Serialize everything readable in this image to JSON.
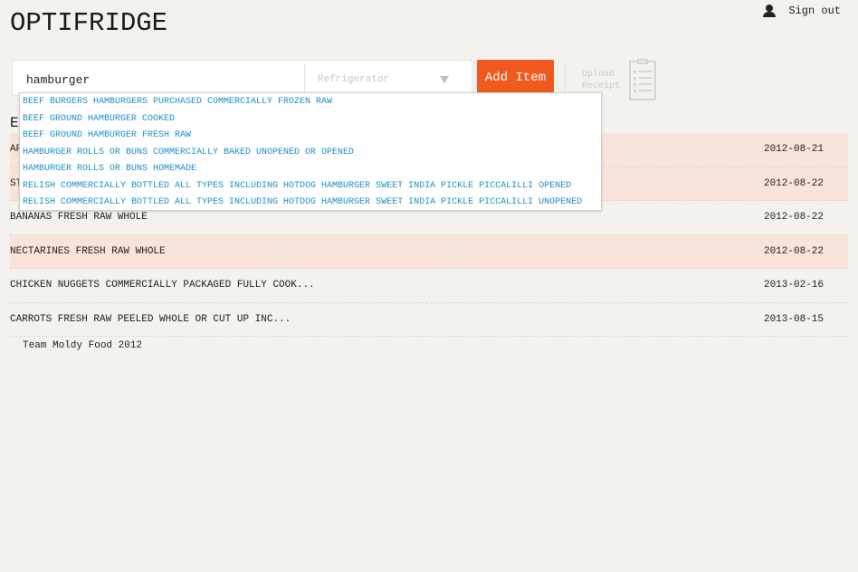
{
  "header": {
    "title": "OPTIFRIDGE",
    "signout_label": "Sign out"
  },
  "search": {
    "value": "hamburger",
    "location_placeholder": "Refrigerator",
    "add_label": "Add Item",
    "upload_label": "Upload Receipt"
  },
  "suggestions": [
    "BEEF BURGERS HAMBURGERS PURCHASED COMMERCIALLY FROZEN RAW",
    "BEEF GROUND HAMBURGER COOKED",
    "BEEF GROUND HAMBURGER FRESH RAW",
    "HAMBURGER ROLLS OR BUNS COMMERCIALLY BAKED UNOPENED OR OPENED",
    "HAMBURGER ROLLS OR BUNS HOMEMADE",
    "RELISH COMMERCIALLY BOTTLED ALL TYPES INCLUDING HOTDOG HAMBURGER SWEET INDIA PICKLE PICCALILLI OPENED",
    "RELISH COMMERCIALLY BOTTLED ALL TYPES INCLUDING HOTDOG HAMBURGER SWEET INDIA PICKLE PICCALILLI UNOPENED"
  ],
  "list": {
    "header": "E",
    "items": [
      {
        "name": "AP",
        "date": "2012-08-21",
        "expiring": true
      },
      {
        "name": "ST",
        "date": "2012-08-22",
        "expiring": true
      },
      {
        "name": "BANANAS FRESH RAW WHOLE",
        "date": "2012-08-22",
        "expiring": false
      },
      {
        "name": "NECTARINES FRESH RAW WHOLE",
        "date": "2012-08-22",
        "expiring": true
      },
      {
        "name": "CHICKEN NUGGETS COMMERCIALLY PACKAGED FULLY COOK...",
        "date": "2013-02-16",
        "expiring": false
      },
      {
        "name": "CARROTS FRESH RAW PEELED WHOLE OR CUT UP INC...",
        "date": "2013-08-15",
        "expiring": false
      }
    ]
  },
  "footer": {
    "text": "Team Moldy Food 2012"
  },
  "colors": {
    "accent": "#f15a1e",
    "link": "#1e8fc8",
    "expiring_row": "#f9e4dc",
    "background": "#f4f2ee"
  }
}
